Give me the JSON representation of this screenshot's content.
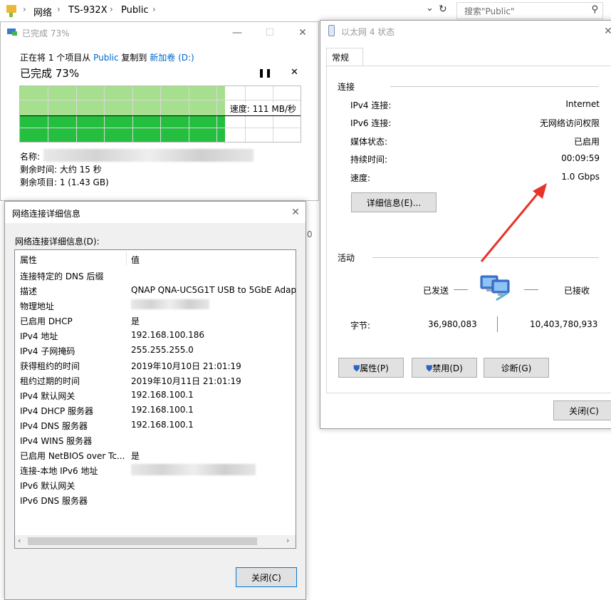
{
  "explorer": {
    "path": [
      "网络",
      "TS-932X",
      "Public"
    ],
    "search_placeholder": "搜索\"Public\"",
    "folder_icon": "folder-icon",
    "colors": {
      "folder": "#e8b839"
    }
  },
  "copy": {
    "title": "已完成 73%",
    "line_prefix": "正在将 1 个项目从 ",
    "source": "Public",
    "line_middle": " 复制到 ",
    "dest": "新加卷 (D:)",
    "heading": "已完成 73%",
    "progress": 0.73,
    "speed_text": "速度: 111 MB/秒",
    "name_label": "名称:",
    "time_remaining": "剩余时间: 大约 15 秒",
    "items_remaining": "剩余项目: 1 (1.43 GB)",
    "colors": {
      "link": "#0066cc",
      "fill_light": "#a6e08f",
      "fill_dark": "#24bf3f"
    }
  },
  "ethernet": {
    "title": "以太网 4 状态",
    "tab": "常规",
    "connection_header": "连接",
    "rows": [
      {
        "label": "IPv4 连接:",
        "value": "Internet"
      },
      {
        "label": "IPv6 连接:",
        "value": "无网络访问权限"
      },
      {
        "label": "媒体状态:",
        "value": "已启用"
      },
      {
        "label": "持续时间:",
        "value": "00:09:59"
      },
      {
        "label": "速度:",
        "value": "1.0 Gbps"
      }
    ],
    "details_button": "详细信息(E)...",
    "activity_header": "活动",
    "sent_label": "已发送",
    "received_label": "已接收",
    "bytes_label": "字节:",
    "bytes_sent": "36,980,083",
    "bytes_received": "10,403,780,933",
    "buttons": {
      "properties": "属性(P)",
      "disable": "禁用(D)",
      "diagnose": "诊断(G)",
      "close": "关闭(C)"
    },
    "annotation_color": "#e8332a"
  },
  "details": {
    "title": "网络连接详细信息",
    "list_label": "网络连接详细信息(D):",
    "headers": {
      "property": "属性",
      "value": "值"
    },
    "rows": [
      {
        "property": "连接特定的 DNS 后缀",
        "value": ""
      },
      {
        "property": "描述",
        "value": "QNAP QNA-UC5G1T USB to 5GbE Adap"
      },
      {
        "property": "物理地址",
        "value": ""
      },
      {
        "property": "已启用 DHCP",
        "value": "是"
      },
      {
        "property": "IPv4 地址",
        "value": "192.168.100.186"
      },
      {
        "property": "IPv4 子网掩码",
        "value": "255.255.255.0"
      },
      {
        "property": "获得租约的时间",
        "value": "2019年10月10日 21:01:19"
      },
      {
        "property": "租约过期的时间",
        "value": "2019年10月11日 21:01:19"
      },
      {
        "property": "IPv4 默认网关",
        "value": "192.168.100.1"
      },
      {
        "property": "IPv4 DHCP 服务器",
        "value": "192.168.100.1"
      },
      {
        "property": "IPv4 DNS 服务器",
        "value": "192.168.100.1"
      },
      {
        "property": "IPv4 WINS 服务器",
        "value": ""
      },
      {
        "property": "已启用 NetBIOS over Tc...",
        "value": "是"
      },
      {
        "property": "连接-本地 IPv6 地址",
        "value": ""
      },
      {
        "property": "IPv6 默认网关",
        "value": ""
      },
      {
        "property": "IPv6 DNS 服务器",
        "value": ""
      }
    ],
    "close_button": "关闭(C)",
    "stray_char": "0"
  }
}
